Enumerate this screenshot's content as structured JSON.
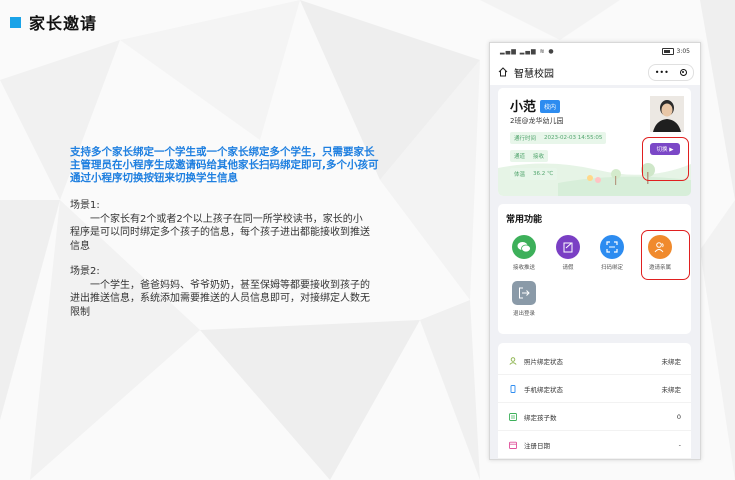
{
  "page_title": "家长邀请",
  "description": "支持多个家长绑定一个学生或一个家长绑定多个学生，只需要家长主管理员在小程序生成邀请码给其他家长扫码绑定即可,多个小孩可通过小程序切换按钮来切换学生信息",
  "scenes": [
    {
      "title": "场景1:",
      "body": "一个家长有2个或者2个以上孩子在同一所学校读书，家长的小程序是可以同时绑定多个孩子的信息，每个孩子进出都能接收到推送信息"
    },
    {
      "title": "场景2:",
      "body": "一个学生，爸爸妈妈、爷爷奶奶，甚至保姆等都要接收到孩子的进出推送信息，系统添加需要推送的人员信息即可，对接绑定人数无限制"
    }
  ],
  "phone": {
    "status": {
      "signal": "▂▄▆ ▂▄▆ ≋ ●",
      "time": "3:05"
    },
    "nav": {
      "title": "智慧校园",
      "more": "•••"
    },
    "profile": {
      "name": "小范",
      "tag": "校内",
      "school": "2班@龙华幼儿园",
      "chips": [
        {
          "label": "通行时间",
          "value": "2023-02-03 14:55:05"
        },
        {
          "label": "通道",
          "value": "接收"
        },
        {
          "label": "体温",
          "value": "36.2 ℃"
        }
      ],
      "switch_label": "切换 ▶"
    },
    "functions": {
      "title": "常用功能",
      "items": [
        {
          "label": "接收推送",
          "color": "#3db05a",
          "icon": "wechat-icon"
        },
        {
          "label": "请假",
          "color": "#7a3fc4",
          "icon": "edit-note-icon"
        },
        {
          "label": "扫码绑定",
          "color": "#2d8cf0",
          "icon": "scan-icon"
        },
        {
          "label": "邀请亲属",
          "color": "#f08a2d",
          "icon": "invite-users-icon"
        },
        {
          "label": "退出登录",
          "color": "#8a9aa8",
          "icon": "logout-icon"
        }
      ]
    },
    "info_rows": [
      {
        "label": "照片绑定状态",
        "value": "未绑定",
        "color": "#8ab24a",
        "icon": "user-icon"
      },
      {
        "label": "手机绑定状态",
        "value": "未绑定",
        "color": "#2d8cf0",
        "icon": "phone-icon"
      },
      {
        "label": "绑定孩子数",
        "value": "0",
        "color": "#3db05a",
        "icon": "list-icon"
      },
      {
        "label": "注册日期",
        "value": "-",
        "color": "#e0509b",
        "icon": "calendar-icon"
      }
    ]
  }
}
